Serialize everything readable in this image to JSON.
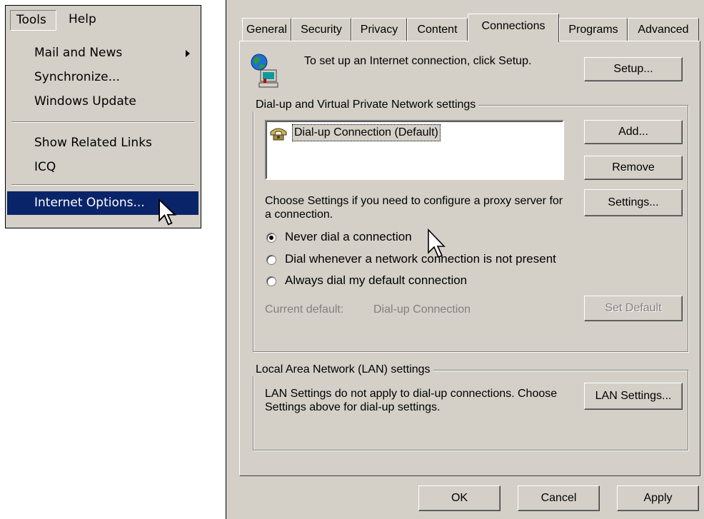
{
  "menu": {
    "menubar": [
      "Tools",
      "Help"
    ],
    "items": [
      {
        "label": "Mail and News",
        "submenu_icon": "chevron-right-icon"
      },
      {
        "label": "Synchronize..."
      },
      {
        "label": "Windows Update"
      },
      {
        "label": "Show Related Links"
      },
      {
        "label": "ICQ"
      },
      {
        "label": "Internet Options...",
        "highlighted": true
      }
    ]
  },
  "dialog": {
    "tabs": [
      "General",
      "Security",
      "Privacy",
      "Content",
      "Connections",
      "Programs",
      "Advanced"
    ],
    "active_tab": "Connections",
    "setup": {
      "text": "To set up an Internet connection, click Setup.",
      "icon": "network-computer-icon",
      "button": "Setup..."
    },
    "dialup_group": {
      "title": "Dial-up and Virtual Private Network settings",
      "connections": [
        {
          "label": "Dial-up Connection (Default)",
          "icon": "dialup-phone-icon"
        }
      ],
      "add_button": "Add...",
      "remove_button": "Remove",
      "proxy_text": "Choose Settings if you need to configure a proxy server for a connection.",
      "settings_button": "Settings...",
      "radios": [
        {
          "label": "Never dial a connection",
          "checked": true
        },
        {
          "label": "Dial whenever a network connection is not present",
          "checked": false
        },
        {
          "label": "Always dial my default connection",
          "checked": false
        }
      ],
      "current_default_label": "Current default:",
      "current_default_value": "Dial-up Connection",
      "set_default_button": "Set Default"
    },
    "lan_group": {
      "title": "Local Area Network (LAN) settings",
      "text": "LAN Settings do not apply to dial-up connections. Choose Settings above for dial-up settings.",
      "button": "LAN Settings..."
    },
    "footer": {
      "ok": "OK",
      "cancel": "Cancel",
      "apply": "Apply"
    }
  },
  "colors": {
    "face": "#d4d0c8",
    "highlight": "#0a246a",
    "shadow": "#808080"
  }
}
